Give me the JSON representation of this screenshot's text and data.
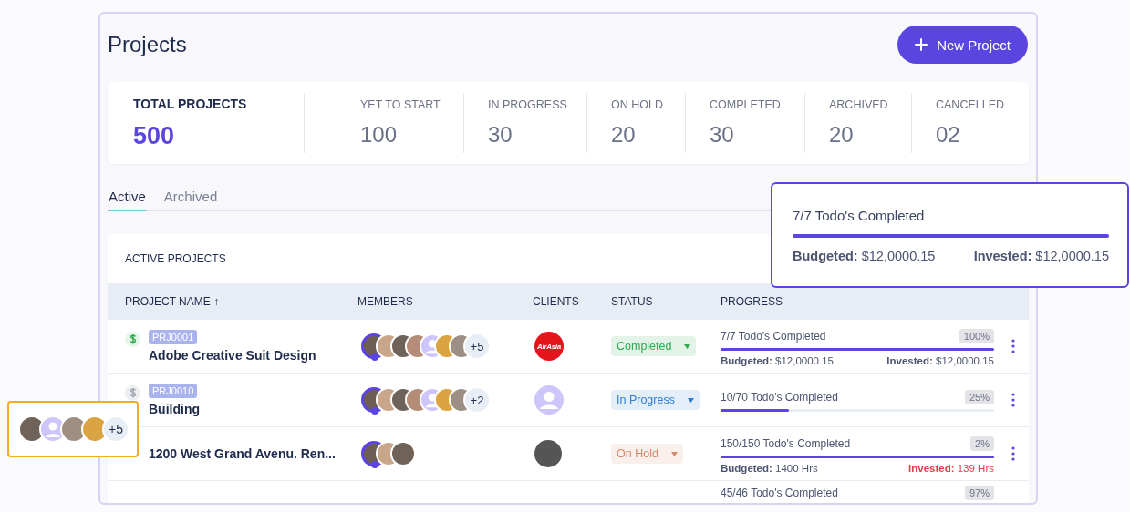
{
  "header": {
    "title": "Projects",
    "new_button": "New Project"
  },
  "stats": [
    {
      "kind": "total",
      "label": "TOTAL PROJECTS",
      "value": "500"
    },
    {
      "kind": "count",
      "label": "YET TO START",
      "value": "100"
    },
    {
      "kind": "count",
      "label": "IN PROGRESS",
      "value": "30"
    },
    {
      "kind": "count",
      "label": "ON HOLD",
      "value": "20"
    },
    {
      "kind": "count",
      "label": "COMPLETED",
      "value": "30"
    },
    {
      "kind": "count",
      "label": "ARCHIVED",
      "value": "20"
    },
    {
      "kind": "count",
      "label": "CANCELLED",
      "value": "02"
    }
  ],
  "tabs": [
    {
      "label": "Active",
      "selected": true
    },
    {
      "label": "Archived",
      "selected": false
    }
  ],
  "table": {
    "title": "ACTIVE PROJECTS",
    "columns": [
      {
        "label": "PROJECT NAME",
        "sort_icon": "↑"
      },
      {
        "label": "MEMBERS"
      },
      {
        "label": "CLIENTS"
      },
      {
        "label": "STATUS"
      },
      {
        "label": "PROGRESS"
      }
    ],
    "rows": [
      {
        "paid": true,
        "code": "PRJ0001",
        "name": "Adobe Creative Suit Design",
        "avatars": [
          {
            "kind": "owner"
          },
          {
            "kind": "photo"
          },
          {
            "kind": "photo"
          },
          {
            "kind": "photo"
          },
          {
            "kind": "placeholder"
          },
          {
            "kind": "photo"
          },
          {
            "kind": "photo"
          }
        ],
        "more": "+5",
        "client": {
          "kind": "logo",
          "text": "AirAsia"
        },
        "status": {
          "label": "Completed",
          "color": "#2fa84f"
        },
        "progress": {
          "label": "7/7 Todo's Completed",
          "percent": "100%",
          "level": 1,
          "budgeted_label": "Budgeted:",
          "budgeted": "$12,0000.15",
          "invested_label": "Invested:",
          "invested": "$12,0000.15",
          "over_budget": false
        },
        "menu": true
      },
      {
        "paid": false,
        "code": "PRJ0010",
        "name": "Building",
        "avatars": [
          {
            "kind": "owner"
          },
          {
            "kind": "photo"
          },
          {
            "kind": "photo"
          },
          {
            "kind": "photo"
          },
          {
            "kind": "placeholder"
          },
          {
            "kind": "photo"
          },
          {
            "kind": "photo"
          }
        ],
        "more": "+2",
        "client": {
          "kind": "placeholder"
        },
        "status": {
          "label": "In Progress",
          "color": "#2f7fd0"
        },
        "progress": {
          "label": "10/70 Todo's Completed",
          "percent": "25%",
          "level": 0.25
        },
        "menu": true
      },
      {
        "name": "1200 West Grand Avenu. Ren...",
        "avatars": [
          {
            "kind": "owner"
          },
          {
            "kind": "photo"
          },
          {
            "kind": "photo"
          }
        ],
        "client": {
          "kind": "photo"
        },
        "status": {
          "label": "On Hold",
          "color": "#d0876a"
        },
        "progress": {
          "label": "150/150 Todo's Completed",
          "percent": "2%",
          "level": 1,
          "budgeted_label": "Budgeted:",
          "budgeted": "1400 Hrs",
          "invested_label": "Invested:",
          "invested": "139 Hrs",
          "over_budget": true
        },
        "menu": true
      },
      {
        "progress": {
          "label": "45/46 Todo's Completed",
          "percent": "97%"
        }
      }
    ]
  },
  "tooltip": {
    "label": "7/7 Todo's Completed",
    "level": 1,
    "budgeted_label": "Budgeted:",
    "budgeted": "$12,0000.15",
    "invested_label": "Invested:",
    "invested": "$12,0000.15"
  },
  "members_popup": {
    "avatars": [
      {
        "kind": "photo"
      },
      {
        "kind": "placeholder"
      },
      {
        "kind": "photo"
      },
      {
        "kind": "photo"
      }
    ],
    "more": "+5"
  }
}
